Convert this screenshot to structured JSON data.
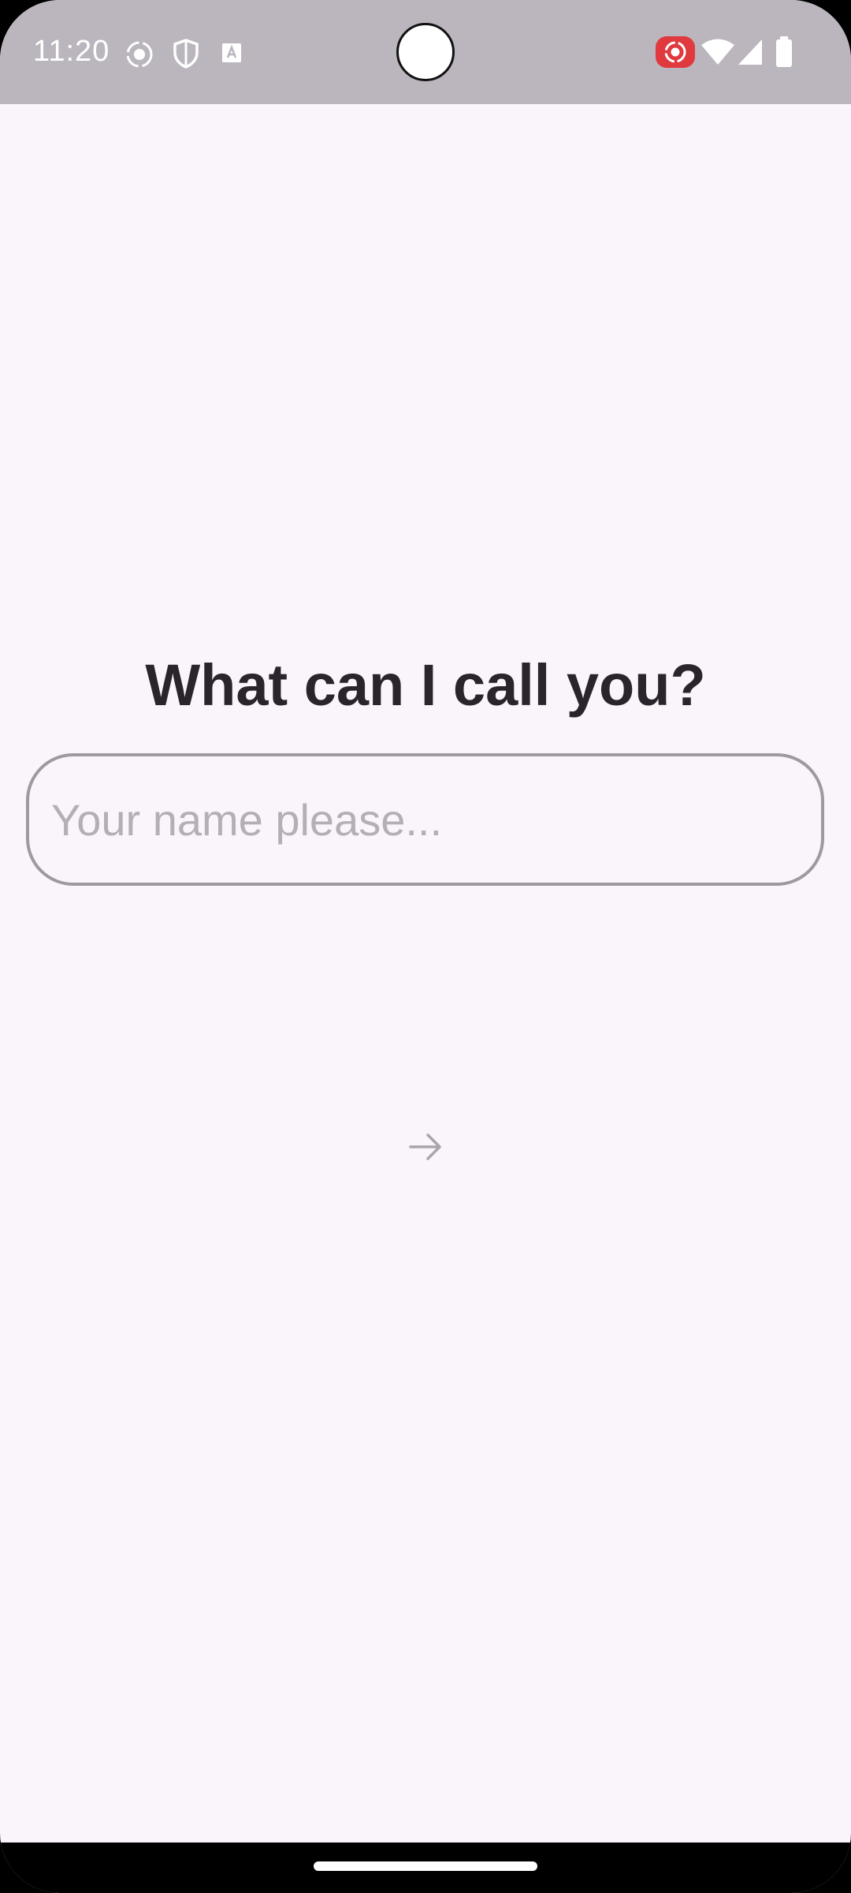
{
  "status_bar": {
    "time": "11:20",
    "left_icons": [
      "screen-record-icon",
      "shield-icon",
      "autofill-icon"
    ],
    "right_icons": [
      "cast-recording-icon",
      "wifi-icon",
      "signal-icon",
      "battery-icon"
    ]
  },
  "onboarding": {
    "title": "What can I call you?",
    "name_input": {
      "value": "",
      "placeholder": "Your name please..."
    },
    "next_icon": "arrow-right-icon"
  },
  "colors": {
    "background": "#faf4fb",
    "status_bar": "#bbb6bd",
    "title_text": "#2a252c",
    "field_border": "#9e989f",
    "placeholder": "#b4afb6",
    "recording_badge": "#e0393e"
  }
}
